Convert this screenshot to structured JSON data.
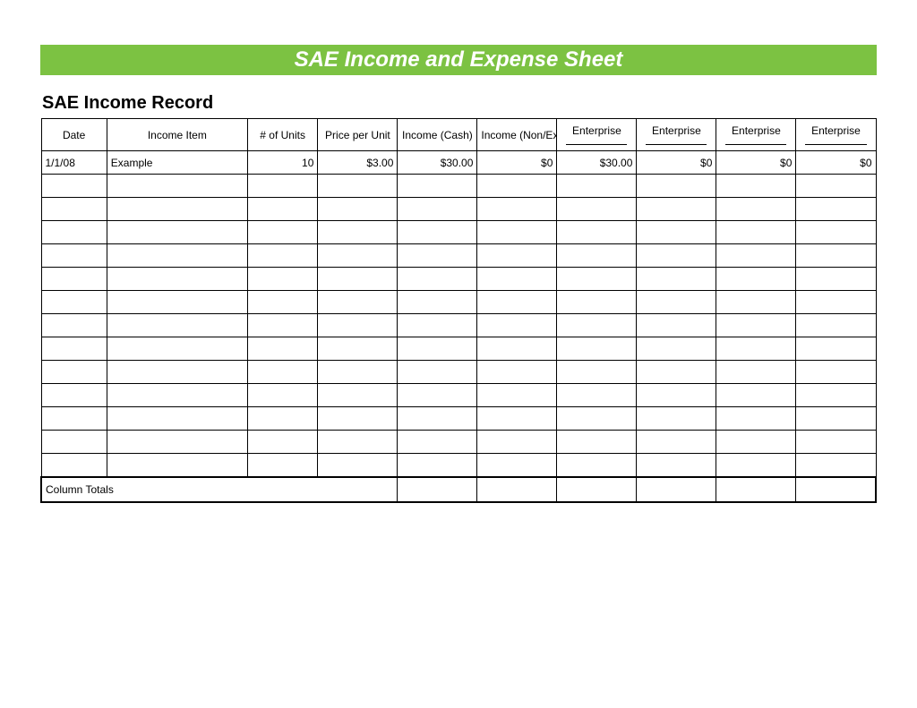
{
  "banner_title": "SAE Income and Expense Sheet",
  "subtitle": "SAE Income Record",
  "headers": {
    "date": "Date",
    "income_item": "Income Item",
    "units": "# of Units",
    "price_per_unit": "Price per Unit",
    "income_cash": "Income (Cash)",
    "income_nonexc": "Income (Non/Exc)",
    "enterprise1": "Enterprise",
    "enterprise2": "Enterprise",
    "enterprise3": "Enterprise",
    "enterprise4": "Enterprise"
  },
  "rows": [
    {
      "date": "1/1/08",
      "income_item": "Example",
      "units": "10",
      "price_per_unit": "$3.00",
      "income_cash": "$30.00",
      "income_nonexc": "$0",
      "enterprise1": "$30.00",
      "enterprise2": "$0",
      "enterprise3": "$0",
      "enterprise4": "$0"
    }
  ],
  "empty_row_count": 13,
  "totals_label": "Column Totals"
}
